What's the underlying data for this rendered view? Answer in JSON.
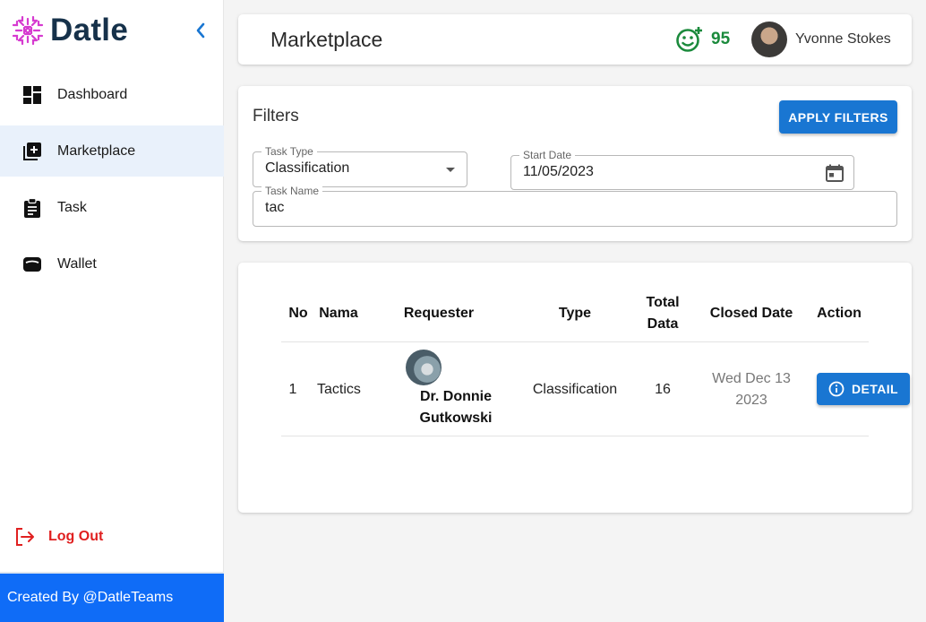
{
  "brand": {
    "name": "Datle"
  },
  "sidebar": {
    "items": [
      {
        "label": "Dashboard",
        "icon": "dashboard-icon"
      },
      {
        "label": "Marketplace",
        "icon": "add-box-icon",
        "active": true
      },
      {
        "label": "Task",
        "icon": "clipboard-icon"
      },
      {
        "label": "Wallet",
        "icon": "wallet-icon"
      }
    ],
    "logout_label": "Log Out",
    "footer": "Created By @DatleTeams"
  },
  "header": {
    "title": "Marketplace",
    "score": "95",
    "user_name": "Yvonne Stokes"
  },
  "filters": {
    "title": "Filters",
    "apply_label": "APPLY FILTERS",
    "task_type": {
      "label": "Task Type",
      "value": "Classification"
    },
    "start_date": {
      "label": "Start Date",
      "value": "11/05/2023"
    },
    "task_name": {
      "label": "Task Name",
      "value": "tac"
    }
  },
  "table": {
    "headers": {
      "no": "No",
      "nama": "Nama",
      "requester": "Requester",
      "type": "Type",
      "total_1": "Total",
      "total_2": "Data",
      "closed": "Closed Date",
      "action": "Action"
    },
    "rows": [
      {
        "no": "1",
        "nama": "Tactics",
        "requester_1": "Dr. Donnie",
        "requester_2": "Gutkowski",
        "type": "Classification",
        "total": "16",
        "closed_1": "Wed Dec 13",
        "closed_2": "2023",
        "action_label": "DETAIL"
      }
    ]
  },
  "colors": {
    "accent": "#1976d2",
    "brand_text": "#16314a",
    "logo": "#d63bd0",
    "score": "#1b8a3c",
    "logout": "#e02020",
    "footer": "#0f6cf7"
  }
}
